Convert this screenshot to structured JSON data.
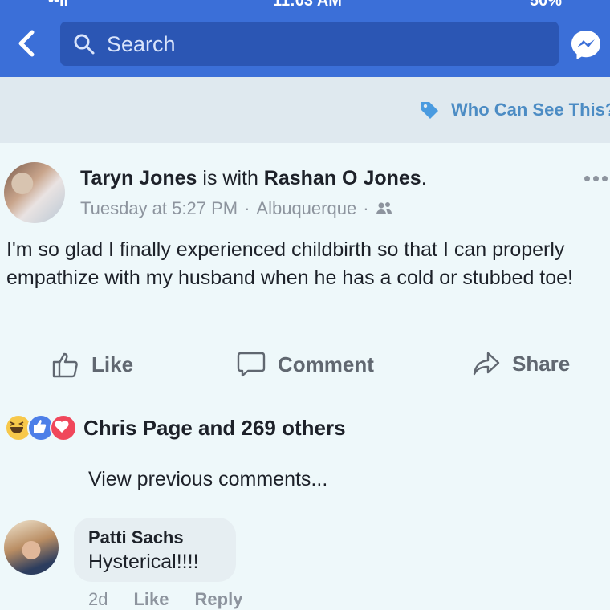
{
  "status_bar": {
    "left": "••ll",
    "center": "11:03 AM",
    "right": "50%"
  },
  "nav": {
    "search_placeholder": "Search"
  },
  "privacy": {
    "label": "Who Can See This?"
  },
  "post": {
    "author": "Taryn Jones",
    "with_text": " is with ",
    "tagged": "Rashan O Jones",
    "period": ".",
    "time": "Tuesday at 5:27 PM",
    "location": "Albuquerque",
    "body": "I'm so glad I finally experienced childbirth so that I can properly empathize with my husband when he has a cold or stubbed toe!"
  },
  "actions": {
    "like": "Like",
    "comment": "Comment",
    "share": "Share"
  },
  "reactions": {
    "summary": "Chris Page and 269 others"
  },
  "comments": {
    "view_previous": "View previous comments...",
    "items": [
      {
        "author": "Patti Sachs",
        "text": "Hysterical!!!!",
        "age": "2d",
        "like": "Like",
        "reply": "Reply"
      }
    ]
  },
  "colors": {
    "brand": "#3b6fd8",
    "link": "#4c8cc4",
    "muted": "#8d949e"
  }
}
